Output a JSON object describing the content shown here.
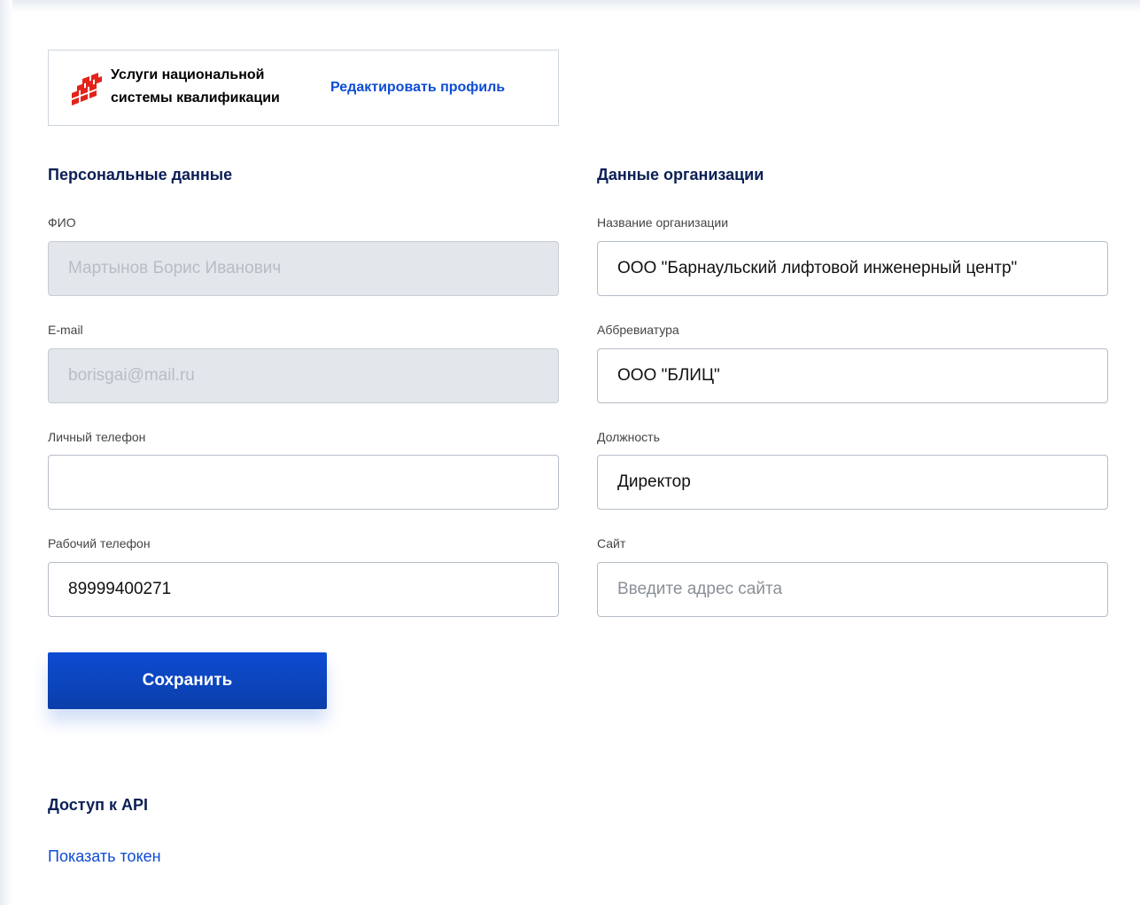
{
  "brand": {
    "line1": "Услуги национальной",
    "line2": "системы квалификации",
    "logo_color": "#e2231a"
  },
  "profile": {
    "edit_link": "Редактировать профиль"
  },
  "personal": {
    "title": "Персональные данные",
    "fio_label": "ФИО",
    "fio_value": "Мартынов Борис Иванович",
    "email_label": "E-mail",
    "email_value": "borisgai@mail.ru",
    "personal_phone_label": "Личный телефон",
    "personal_phone_value": "",
    "work_phone_label": "Рабочий телефон",
    "work_phone_value": "89999400271"
  },
  "organization": {
    "title": "Данные организации",
    "name_label": "Название организации",
    "name_value": "ООО \"Барнаульский лифтовой инженерный центр\"",
    "abbr_label": "Аббревиатура",
    "abbr_value": "ООО \"БЛИЦ\"",
    "position_label": "Должность",
    "position_value": "Директор",
    "site_label": "Сайт",
    "site_placeholder": "Введите адрес сайта"
  },
  "actions": {
    "save_label": "Сохранить"
  },
  "api": {
    "title": "Доступ к API",
    "show_token": "Показать токен"
  },
  "colors": {
    "accent": "#0d4cd3",
    "heading": "#0b1f56",
    "disabled_bg": "#e3e6ea"
  }
}
